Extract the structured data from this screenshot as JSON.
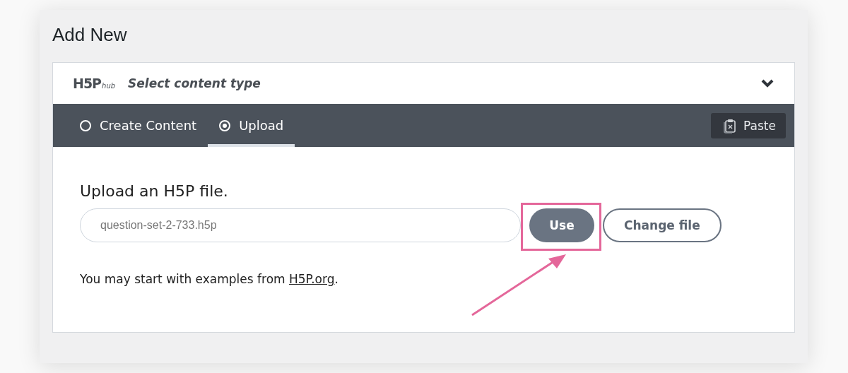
{
  "page_title": "Add New",
  "hub": {
    "logo": "H5P",
    "logo_suffix": "hub",
    "title": "Select content type",
    "expanded": true
  },
  "tabs": [
    {
      "label": "Create Content",
      "selected": false
    },
    {
      "label": "Upload",
      "selected": true
    }
  ],
  "paste_button": "Paste",
  "upload": {
    "heading": "Upload an H5P file.",
    "file_value": "question-set-2-733.h5p",
    "use_button": "Use",
    "change_button": "Change file",
    "highlighted": true
  },
  "note": {
    "text": "You may start with examples from ",
    "link": "H5P.org",
    "suffix": "."
  }
}
